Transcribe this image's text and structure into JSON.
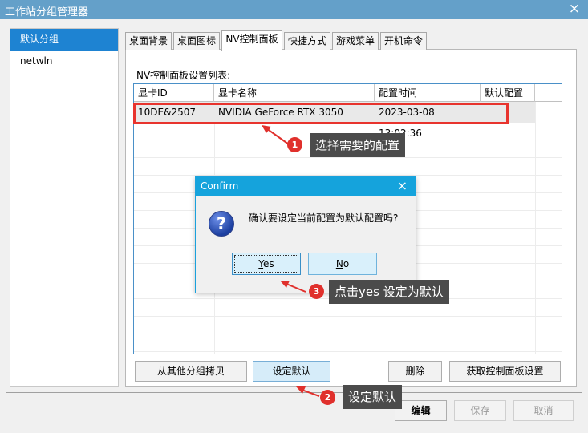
{
  "window": {
    "title": "工作站分组管理器",
    "close_icon": "×"
  },
  "sidebar": {
    "items": [
      {
        "label": "默认分组",
        "active": true
      },
      {
        "label": "netwln",
        "active": false
      }
    ]
  },
  "tabs": [
    {
      "label": "桌面背景"
    },
    {
      "label": "桌面图标"
    },
    {
      "label": "NV控制面板",
      "active": true
    },
    {
      "label": "快捷方式"
    },
    {
      "label": "游戏菜单"
    },
    {
      "label": "开机命令"
    }
  ],
  "panel": {
    "label": "NV控制面板设置列表:",
    "columns": [
      "显卡ID",
      "显卡名称",
      "配置时间",
      "默认配置"
    ],
    "rows": [
      {
        "id": "10DE&2507",
        "name": "NVIDIA GeForce RTX 3050",
        "time": "2023-03-08 13:02:36",
        "default": ""
      }
    ]
  },
  "buttons": {
    "copy": "从其他分组拷贝",
    "set_default": "设定默认",
    "delete": "删除",
    "fetch": "获取控制面板设置"
  },
  "footer": {
    "edit": "编辑",
    "save": "保存",
    "cancel": "取消"
  },
  "dialog": {
    "title": "Confirm",
    "message": "确认要设定当前配置为默认配置吗?",
    "yes_letter": "Y",
    "yes_rest": "es",
    "no_letter": "N",
    "no_rest": "o"
  },
  "annotations": [
    {
      "num": "1",
      "text": "选择需要的配置"
    },
    {
      "num": "2",
      "text": "设定默认"
    },
    {
      "num": "3",
      "text": "点击yes 设定为默认"
    }
  ],
  "colors": {
    "accent": "#1e83d2",
    "highlight": "#e8342e",
    "callout": "#4b4b4b",
    "badge": "#e0302c"
  }
}
